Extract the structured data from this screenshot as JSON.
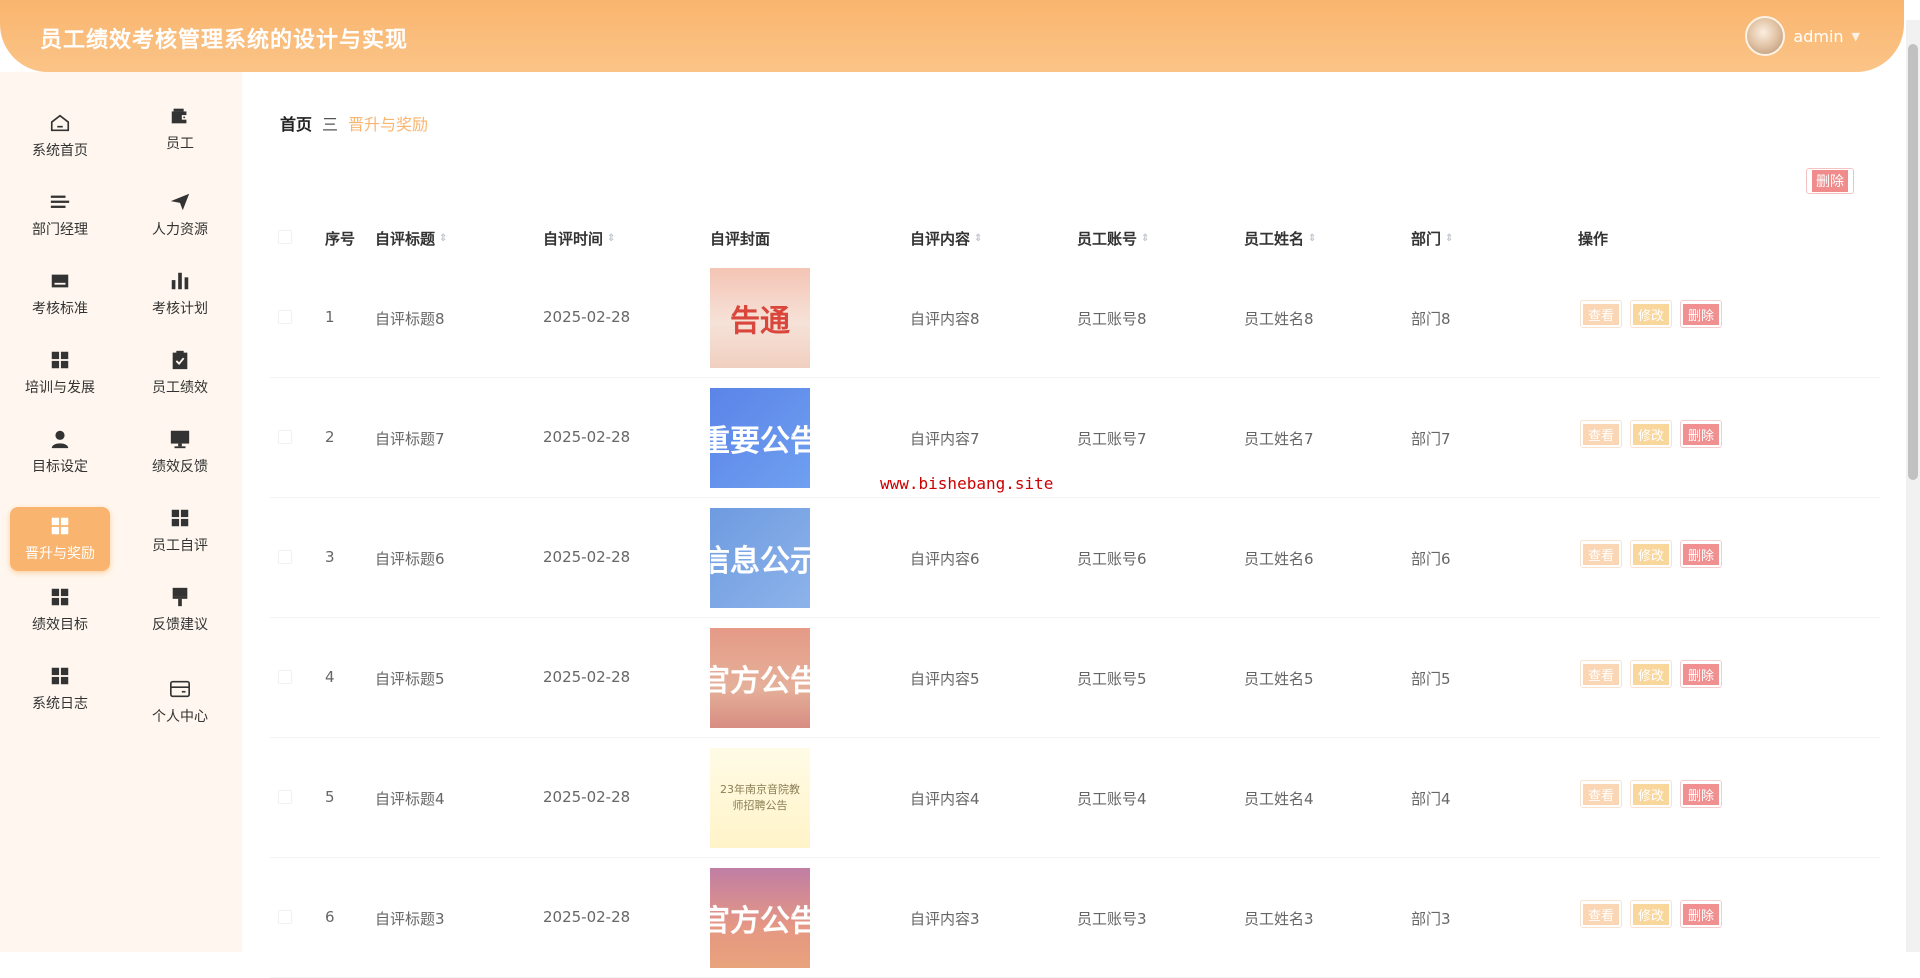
{
  "header": {
    "title": "员工绩效考核管理系统的设计与实现",
    "user": "admin",
    "caret": "▼"
  },
  "sidebar": {
    "items": [
      {
        "label": "系统首页",
        "icon": "home-icon"
      },
      {
        "label": "员工",
        "icon": "wallet-icon"
      },
      {
        "label": "部门经理",
        "icon": "list-icon"
      },
      {
        "label": "人力资源",
        "icon": "send-icon"
      },
      {
        "label": "考核标准",
        "icon": "inbox-icon"
      },
      {
        "label": "考核计划",
        "icon": "chart-icon"
      },
      {
        "label": "培训与发展",
        "icon": "grid-icon"
      },
      {
        "label": "员工绩效",
        "icon": "clipboard-check-icon"
      },
      {
        "label": "目标设定",
        "icon": "user-icon"
      },
      {
        "label": "绩效反馈",
        "icon": "monitor-icon"
      },
      {
        "label": "晋升与奖励",
        "icon": "grid-icon",
        "active": true
      },
      {
        "label": "员工自评",
        "icon": "grid-icon"
      },
      {
        "label": "绩效目标",
        "icon": "grid-icon"
      },
      {
        "label": "反馈建议",
        "icon": "brush-icon"
      },
      {
        "label": "系统日志",
        "icon": "grid-icon"
      },
      {
        "label": "个人中心",
        "icon": "card-icon"
      }
    ]
  },
  "breadcrumb": {
    "home": "首页",
    "separator": "三",
    "current": "晋升与奖励"
  },
  "toolbar": {
    "delete_label": "删除"
  },
  "table": {
    "headers": {
      "index": "序号",
      "title": "自评标题",
      "time": "自评时间",
      "cover": "自评封面",
      "content": "自评内容",
      "account": "员工账号",
      "name": "员工姓名",
      "dept": "部门",
      "ops": "操作"
    },
    "sort_icon": "⇕",
    "actions": {
      "view": "查看",
      "edit": "修改",
      "delete": "删除"
    },
    "rows": [
      {
        "index": "1",
        "title": "自评标题8",
        "time": "2025-02-28",
        "cover": "告通",
        "content": "自评内容8",
        "account": "员工账号8",
        "name": "员工姓名8",
        "dept": "部门8"
      },
      {
        "index": "2",
        "title": "自评标题7",
        "time": "2025-02-28",
        "cover": "重要公告",
        "content": "自评内容7",
        "account": "员工账号7",
        "name": "员工姓名7",
        "dept": "部门7"
      },
      {
        "index": "3",
        "title": "自评标题6",
        "time": "2025-02-28",
        "cover": "信息公示",
        "content": "自评内容6",
        "account": "员工账号6",
        "name": "员工姓名6",
        "dept": "部门6"
      },
      {
        "index": "4",
        "title": "自评标题5",
        "time": "2025-02-28",
        "cover": "官方公告",
        "content": "自评内容5",
        "account": "员工账号5",
        "name": "员工姓名5",
        "dept": "部门5"
      },
      {
        "index": "5",
        "title": "自评标题4",
        "time": "2025-02-28",
        "cover": "23年南京音院教师招聘公告",
        "content": "自评内容4",
        "account": "员工账号4",
        "name": "员工姓名4",
        "dept": "部门4"
      },
      {
        "index": "6",
        "title": "自评标题3",
        "time": "2025-02-28",
        "cover": "官方公告",
        "content": "自评内容3",
        "account": "员工账号3",
        "name": "员工姓名3",
        "dept": "部门3"
      }
    ]
  },
  "watermark": "www.bishebang.site",
  "colors": {
    "accent": "#f9b56f",
    "danger": "#f09090",
    "warning": "#f9d79c"
  }
}
